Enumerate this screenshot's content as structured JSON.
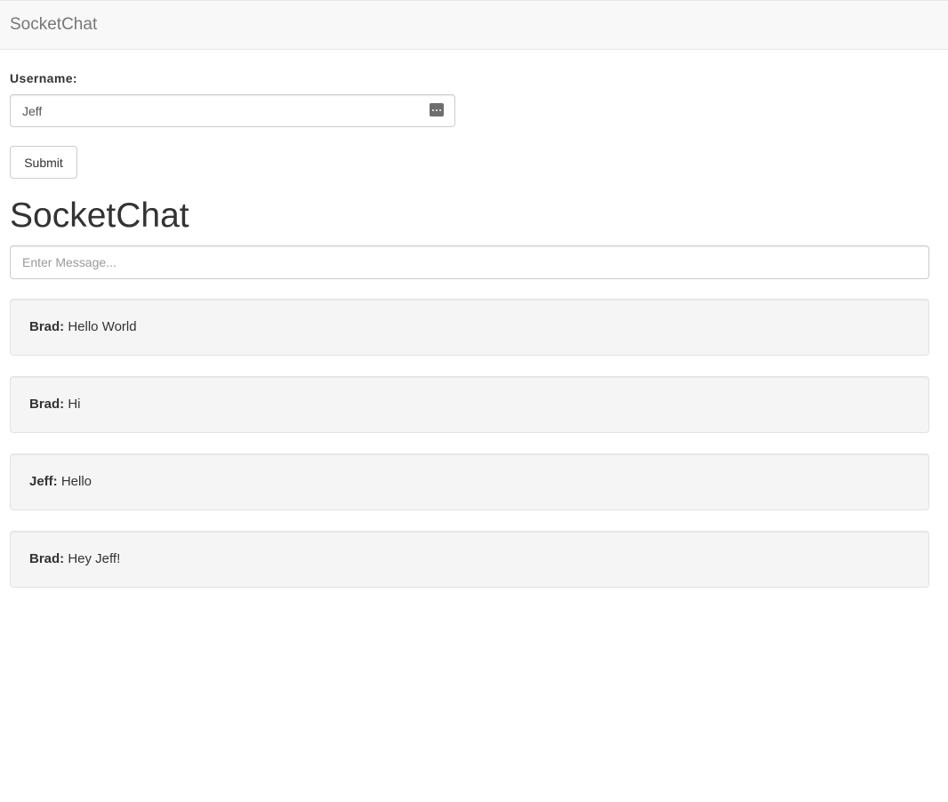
{
  "navbar": {
    "brand": "SocketChat"
  },
  "user_form": {
    "label": "Username:",
    "value": "Jeff",
    "password_manager_icon": "password-manager-icon",
    "submit_label": "Submit"
  },
  "chat": {
    "title": "SocketChat",
    "input_placeholder": "Enter Message...",
    "messages": [
      {
        "user": "Brad:",
        "text": "Hello World"
      },
      {
        "user": "Brad:",
        "text": "Hi"
      },
      {
        "user": "Jeff:",
        "text": "Hello"
      },
      {
        "user": "Brad:",
        "text": "Hey Jeff!"
      }
    ]
  },
  "colors": {
    "navbar_bg": "#f8f8f8",
    "message_bg": "#f5f5f5",
    "text": "#333333",
    "brand_text": "#777777"
  }
}
